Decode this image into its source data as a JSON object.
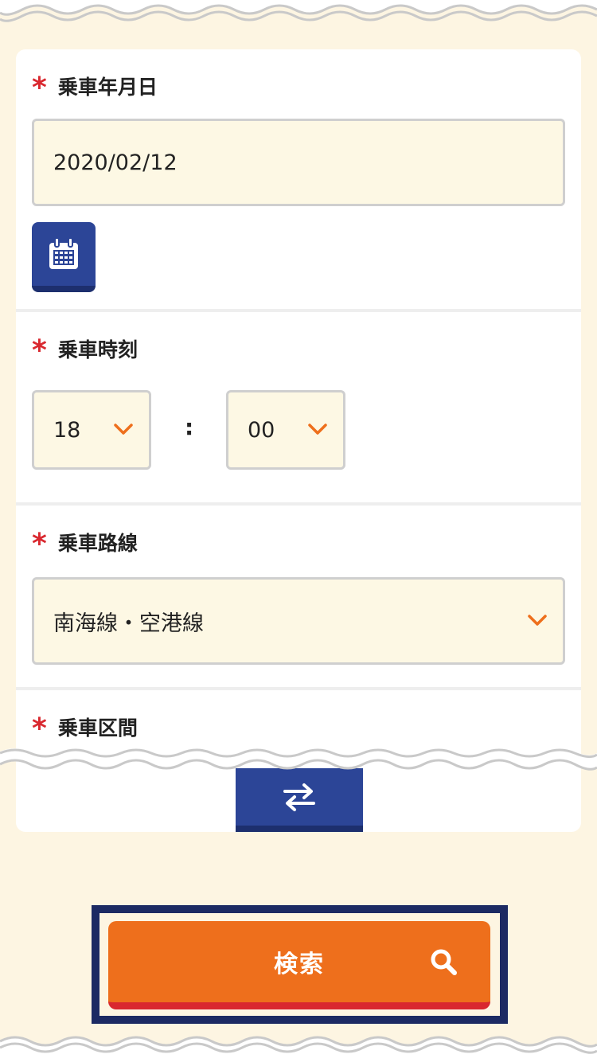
{
  "form": {
    "required_mark": "*",
    "date": {
      "label": "乗車年月日",
      "value": "2020/02/12",
      "calendar_icon": "calendar-icon"
    },
    "time": {
      "label": "乗車時刻",
      "hour": "18",
      "separator": ":",
      "minute": "00",
      "chevron_icon": "chevron-down-icon"
    },
    "line": {
      "label": "乗車路線",
      "value": "南海線・空港線",
      "chevron_icon": "chevron-down-icon"
    },
    "stations": {
      "label": "乗車区間",
      "swap_icon": "swap-icon"
    }
  },
  "search": {
    "label": "検索",
    "icon": "search-icon"
  },
  "colors": {
    "background": "#fdf5e2",
    "field_bg": "#fdf8e4",
    "accent_blue": "#2c4597",
    "accent_orange": "#ee6f1c",
    "required_red": "#d9282f",
    "focus_navy": "#1c2a63"
  }
}
